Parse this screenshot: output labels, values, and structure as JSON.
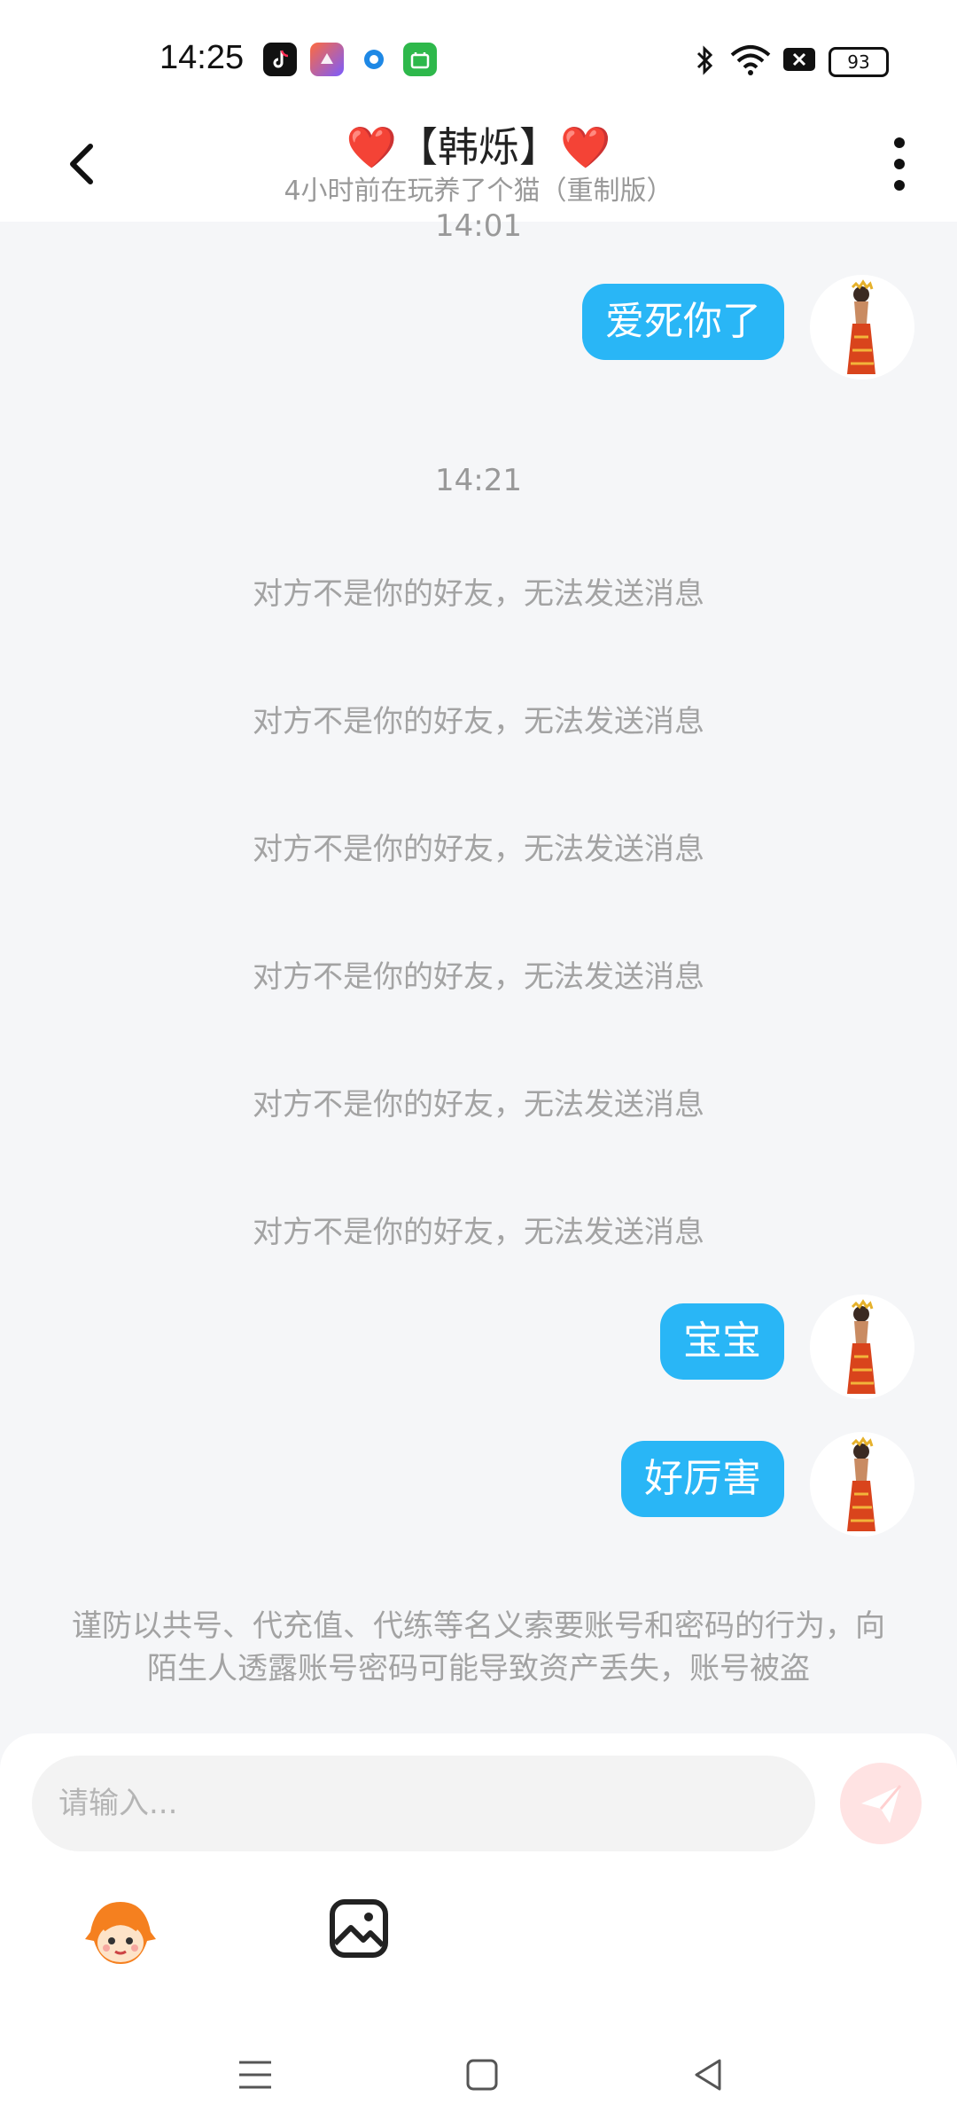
{
  "status_bar": {
    "time": "14:25",
    "app_icons": [
      "tiktok-icon",
      "kuaishou-icon",
      "browser-icon",
      "app-store-icon"
    ],
    "battery": "93",
    "indicators": [
      "bluetooth-icon",
      "wifi-icon",
      "sim-icon"
    ]
  },
  "header": {
    "back_icon": "chevron-left-icon",
    "title": "❤️【韩烁】❤️",
    "subtitle": "4小时前在玩养了个猫（重制版）",
    "more_icon": "more-vertical-icon"
  },
  "chat": {
    "timestamp_top": "14:01",
    "timestamp_mid": "14:21",
    "messages": [
      {
        "type": "sent",
        "text": "爱死你了"
      },
      {
        "type": "system",
        "text": "对方不是你的好友，无法发送消息"
      },
      {
        "type": "system",
        "text": "对方不是你的好友，无法发送消息"
      },
      {
        "type": "system",
        "text": "对方不是你的好友，无法发送消息"
      },
      {
        "type": "system",
        "text": "对方不是你的好友，无法发送消息"
      },
      {
        "type": "system",
        "text": "对方不是你的好友，无法发送消息"
      },
      {
        "type": "system",
        "text": "对方不是你的好友，无法发送消息"
      },
      {
        "type": "sent",
        "text": "宝宝"
      },
      {
        "type": "sent",
        "text": "好厉害"
      }
    ],
    "warning": "谨防以共号、代充值、代练等名义索要账号和密码的行为，向陌生人透露账号密码可能导致资产丢失，账号被盗"
  },
  "input": {
    "placeholder": "请输入...",
    "send_icon": "paper-plane-icon",
    "emoji_icon": "mascot-emoji-icon",
    "image_icon": "image-icon"
  },
  "navbar": {
    "items": [
      "menu-icon",
      "home-square-icon",
      "back-triangle-icon"
    ]
  },
  "colors": {
    "bubble": "#29b6f6",
    "background": "#f5f6f8",
    "send_button": "#ffe3e3"
  }
}
